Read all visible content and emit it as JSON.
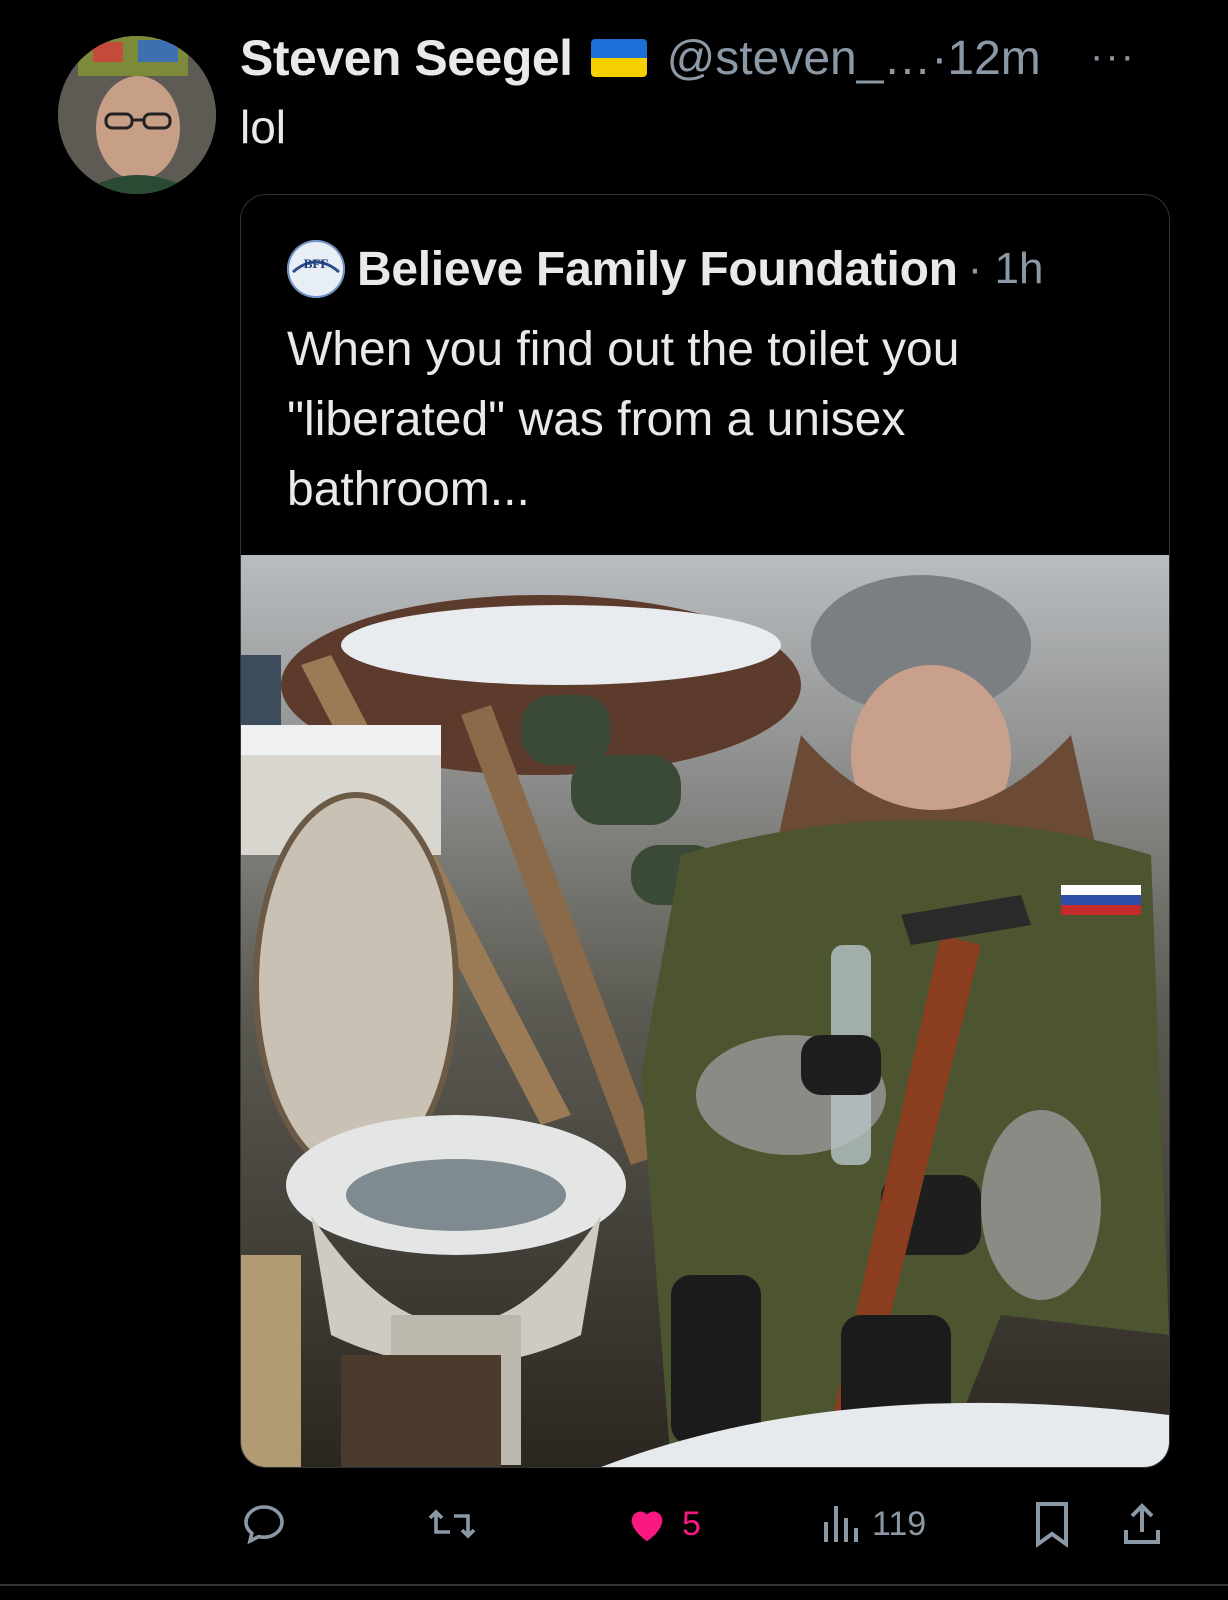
{
  "author": {
    "name": "Steven Seegel",
    "handle": "@steven_…",
    "time": "·12m",
    "more": "···"
  },
  "tweet": {
    "text": "lol"
  },
  "quoted": {
    "name": "Believe Family Foundation",
    "time": "· 1h",
    "avatar_text": "BFF",
    "text": "When you find out the toilet you \"liberated\" was from a unisex bathroom..."
  },
  "actions": {
    "reply_count": "",
    "retweet_count": "",
    "like_count": "5",
    "views_count": "119"
  },
  "colors": {
    "like": "#f91880",
    "muted": "#8b98a5",
    "text": "#e7e9ea"
  },
  "icons": [
    "reply-icon",
    "retweet-icon",
    "heart-icon",
    "views-icon",
    "bookmark-icon",
    "share-icon"
  ]
}
